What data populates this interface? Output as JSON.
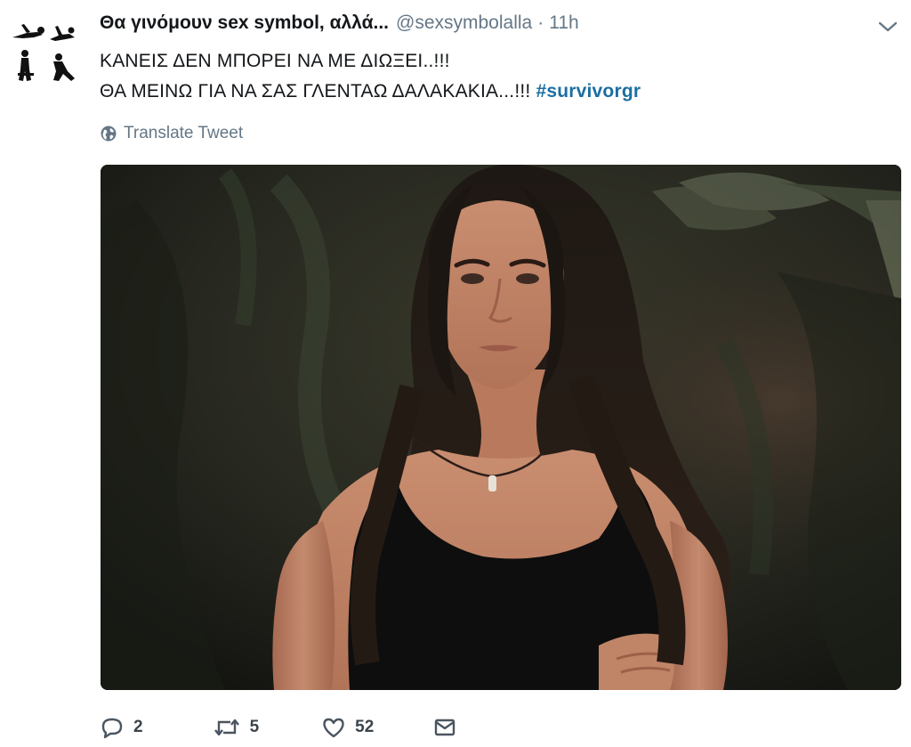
{
  "tweet": {
    "display_name": "Θα γινόμουν sex symbol, αλλά...",
    "handle": "@sexsymbolalla",
    "separator": "·",
    "time": "11h",
    "text_line_1": "ΚΑΝΕΙΣ ΔΕΝ ΜΠΟΡΕΙ ΝΑ ΜΕ ΔΙΩΞΕΙ..!!!",
    "text_line_2": "ΘΑ ΜΕΙΝΩ ΓΙΑ ΝΑ ΣΑΣ ΓΛΕΝΤΑΩ ΔΑΛΑΚΑΚΙΑ...!!! ",
    "hashtag": "#survivorgr",
    "translate_label": "Translate Tweet"
  },
  "actions": {
    "replies": "2",
    "retweets": "5",
    "likes": "52"
  },
  "icons": {
    "avatar": "silhouette-figures-avatar",
    "more": "chevron-down-icon",
    "translate": "globe-icon",
    "reply": "reply-icon",
    "retweet": "retweet-icon",
    "like": "heart-icon",
    "message": "envelope-icon"
  },
  "colors": {
    "hashtag": "#1b6ea0",
    "secondary_text": "#657786",
    "primary_text": "#14171a"
  }
}
